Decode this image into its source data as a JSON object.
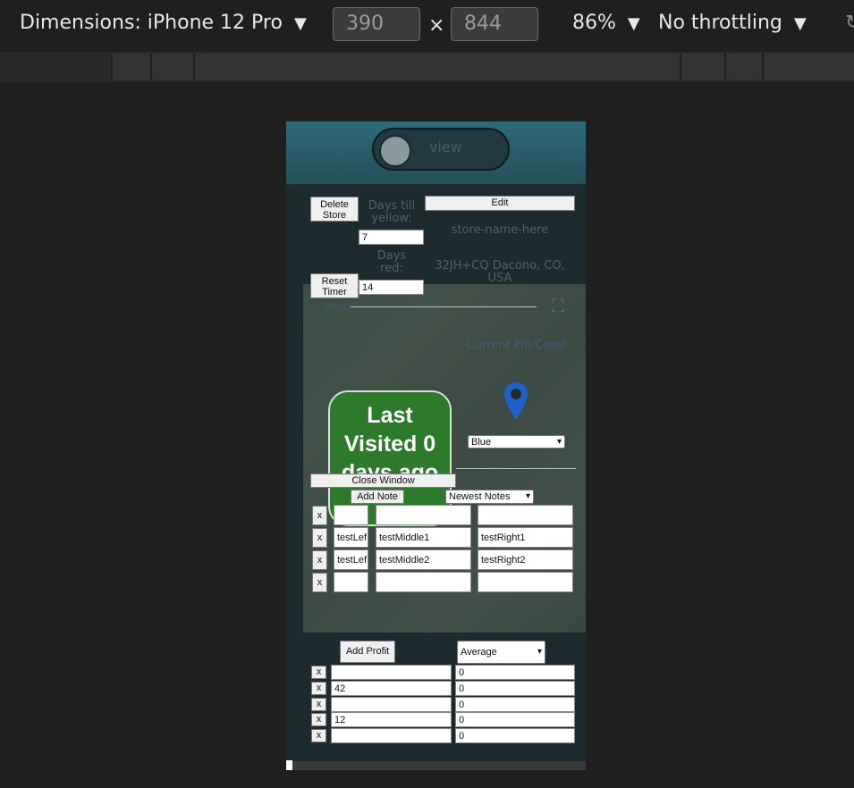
{
  "devtools": {
    "dimensions_label": "Dimensions: iPhone 12 Pro",
    "width": "390",
    "times": "×",
    "height": "844",
    "zoom": "86%",
    "throttling": "No throttling",
    "dropdown_caret": "▼"
  },
  "app": {
    "view_toggle_label": "view",
    "delete_store_label": "Delete Store",
    "days_till_yellow_label": "Days till yellow:",
    "days_till_yellow_value": "7",
    "days_red_label": "Days red:",
    "days_red_value": "14",
    "reset_timer_label": "Reset Timer",
    "edit_label": "Edit",
    "store_name": "store-name-here",
    "address": "32JH+CQ Dacono, CO, USA",
    "map_label": "Map",
    "last_visited_text": "Last Visited 0 days ago",
    "current_pin_color_label": "Current Pin Color",
    "pin_color": "#1e62c8",
    "pin_color_value": "Blue",
    "close_window_label": "Close Window",
    "add_note_label": "Add Note",
    "notes_sort_value": "Newest Notes",
    "notes": [
      {
        "delete": "x",
        "left": "",
        "middle": "",
        "right": ""
      },
      {
        "delete": "x",
        "left": "testLef",
        "middle": "testMiddle1",
        "right": "testRight1"
      },
      {
        "delete": "x",
        "left": "testLef",
        "middle": "testMiddle2",
        "right": "testRight2"
      },
      {
        "delete": "x",
        "left": "",
        "middle": "",
        "right": ""
      }
    ],
    "add_profit_label": "Add Profit",
    "profit_mode_value": "Average",
    "profits": [
      {
        "delete": "x",
        "amount": "",
        "value": "0"
      },
      {
        "delete": "x",
        "amount": "42",
        "value": "0"
      },
      {
        "delete": "x",
        "amount": "",
        "value": "0"
      },
      {
        "delete": "x",
        "amount": "12",
        "value": "0"
      },
      {
        "delete": "x",
        "amount": "",
        "value": "0"
      }
    ]
  },
  "colors": {
    "last_visited_bg": "#2d7a2d",
    "devtools_bg": "#1f1f1f"
  }
}
